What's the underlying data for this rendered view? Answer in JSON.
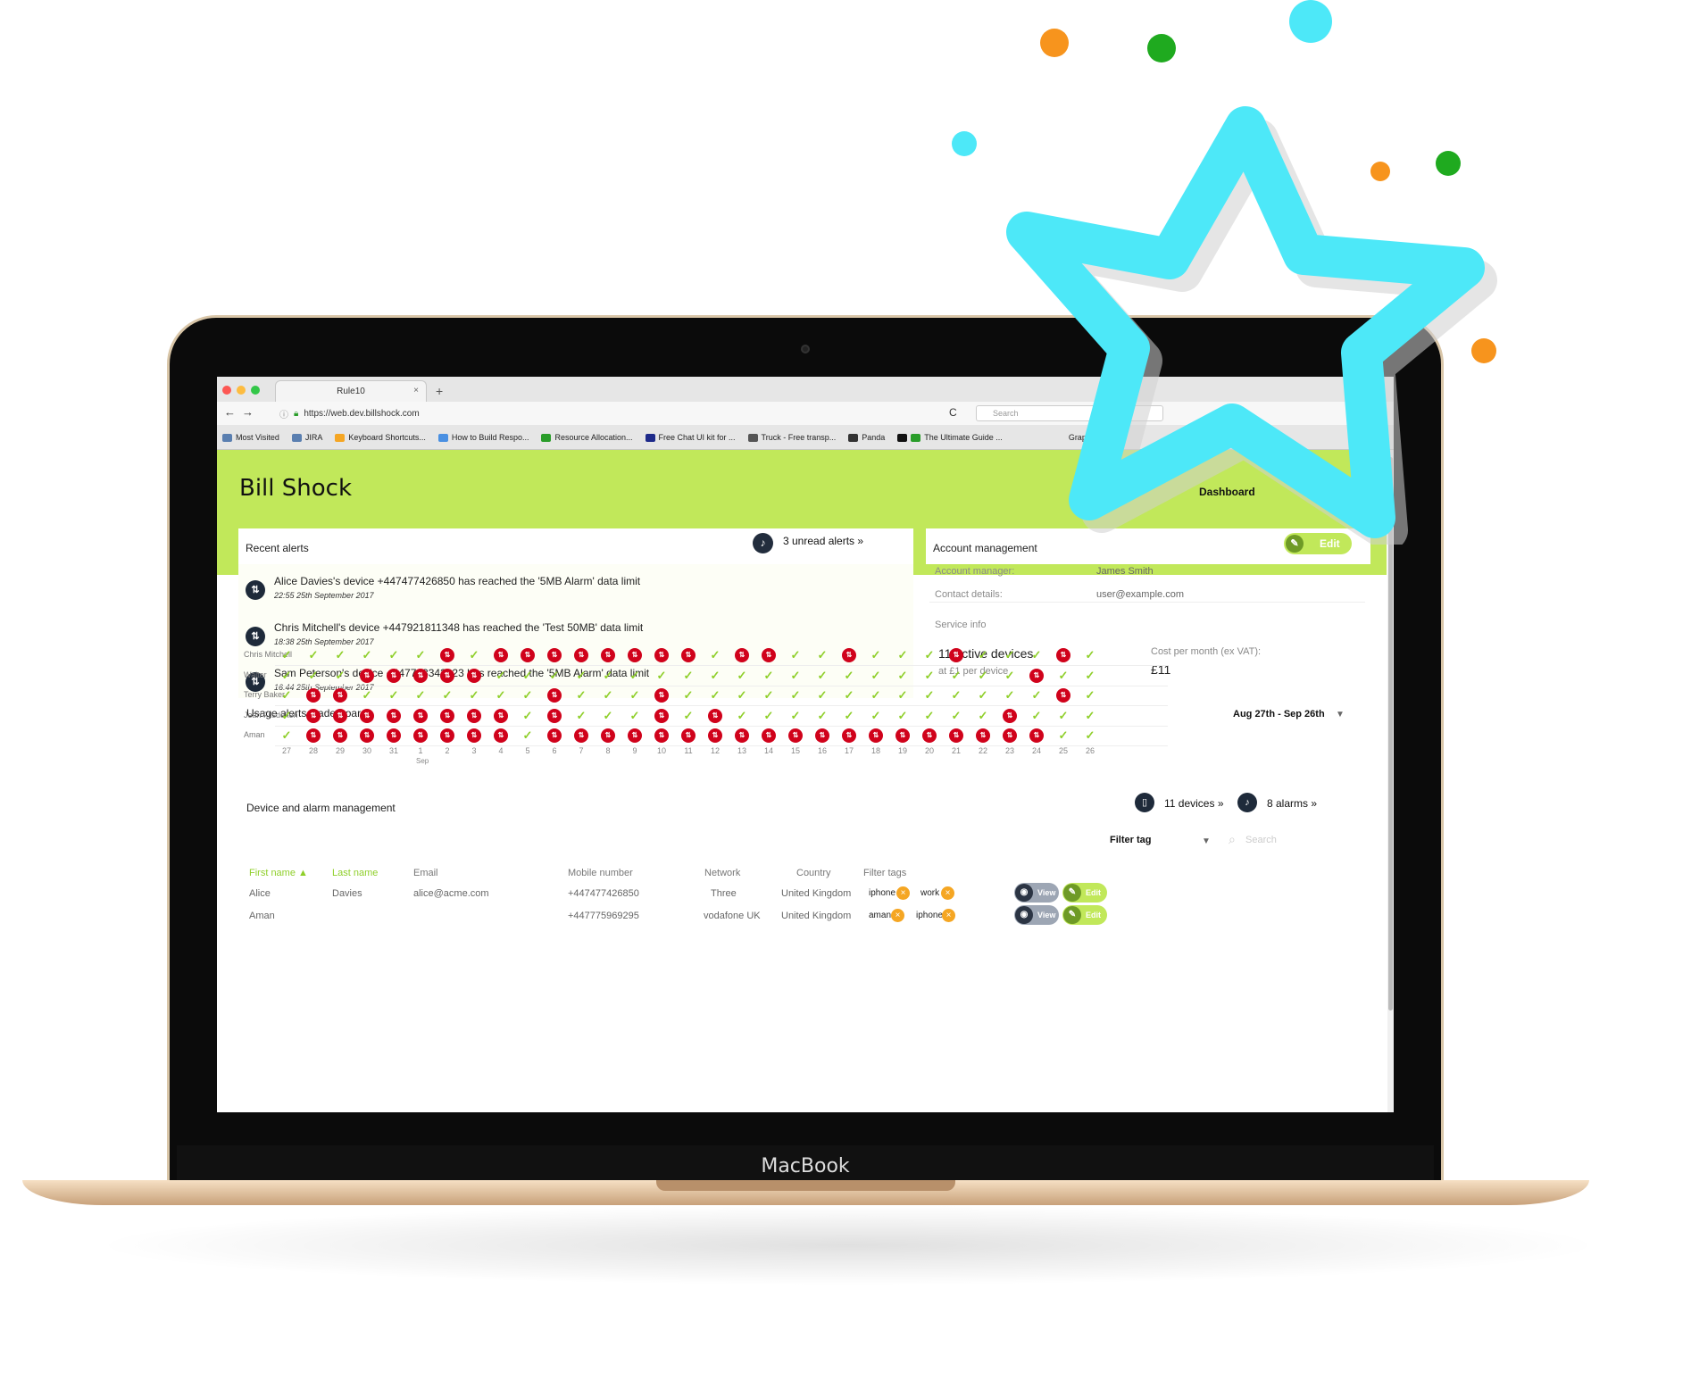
{
  "laptop": {
    "brand": "MacBook"
  },
  "browser": {
    "tab_title": "Rule10",
    "tab_close": "×",
    "new_tab": "+",
    "back": "←",
    "forward": "→",
    "url": "https://web.dev.billshock.com",
    "reload": "C",
    "search_placeholder": "Search",
    "bookmarks": [
      "Most Visited",
      "JIRA",
      "Keyboard Shortcuts...",
      "How to Build Respo...",
      "Resource Allocation...",
      "Free Chat UI kit for ...",
      "Truck - Free transp...",
      "Panda",
      "The Ultimate Guide ...",
      "GraphicBurger"
    ],
    "more": "»"
  },
  "app": {
    "title": "Bill Shock",
    "nav": {
      "dashboard": "Dashboard"
    }
  },
  "recent_alerts": {
    "title": "Recent alerts",
    "unread": "3 unread alerts »",
    "items": [
      {
        "text": "Alice Davies's device +447477426850 has reached the '5MB Alarm' data limit",
        "time": "22:55 25th September 2017"
      },
      {
        "text": "Chris Mitchell's device +447921811348 has reached the 'Test 50MB' data limit",
        "time": "18:38 25th September 2017"
      },
      {
        "text": "Sam Peterson's device +447763343023 has reached the '5MB Alarm' data limit",
        "time": "16:44 25th September 2017"
      }
    ]
  },
  "account": {
    "title": "Account management",
    "edit": "Edit",
    "manager_label": "Account manager:",
    "manager_value": "James Smith",
    "contact_label": "Contact details:",
    "contact_value": "user@example.com",
    "service_label": "Service info",
    "devices": "11 active devices",
    "per_device": "at £1 per device",
    "cost_label": "Cost per month (ex VAT):",
    "cost_value": "£11"
  },
  "leaderboard": {
    "title": "Usage alerts leaderboard",
    "range": "Aug 27th - Sep 26th",
    "days": [
      "27",
      "28",
      "29",
      "30",
      "31",
      "1",
      "2",
      "3",
      "4",
      "5",
      "6",
      "7",
      "8",
      "9",
      "10",
      "11",
      "12",
      "13",
      "14",
      "15",
      "16",
      "17",
      "18",
      "19",
      "20",
      "21",
      "22",
      "23",
      "24",
      "25",
      "26"
    ],
    "month_marker": "Sep",
    "rows": [
      {
        "name": "Chris Mitchell",
        "marks": "ooooooxoxxxxxxxxoxxooxoooxoooxo"
      },
      {
        "name": "Walter",
        "marks": "oooxxxxxooooooooooooooooooooxoo"
      },
      {
        "name": "Terry Baker",
        "marks": "oxxoooooooxoooxooooooooooooooxoo"
      },
      {
        "name": "Jean Filsdeken",
        "marks": "oxxxxxxxxoxoooxoxooooooooooxooo"
      },
      {
        "name": "Aman",
        "marks": "oxxxxxxxxoxxxxxxxxxxxxxxxxxxxoo"
      }
    ]
  },
  "devices": {
    "title": "Device and alarm management",
    "devices_link": "11 devices »",
    "alarms_link": "8 alarms »",
    "filter_label": "Filter tag",
    "search_placeholder": "Search",
    "headers": [
      "First name ▲",
      "Last name",
      "Email",
      "Mobile number",
      "Network",
      "Country",
      "Filter tags"
    ],
    "rows": [
      {
        "first": "Alice",
        "last": "Davies",
        "email": "alice@acme.com",
        "mobile": "+447477426850",
        "network": "Three",
        "country": "United Kingdom",
        "tags": [
          "iphone",
          "work"
        ]
      },
      {
        "first": "Aman",
        "last": "",
        "email": "",
        "mobile": "+447775969295",
        "network": "vodafone UK",
        "country": "United Kingdom",
        "tags": [
          "aman",
          "iphone"
        ]
      }
    ],
    "view": "View",
    "edit": "Edit"
  },
  "colors": {
    "accent": "#c1e85a",
    "dark": "#1e2a3a",
    "alert": "#d0021b",
    "ok": "#8fcf2a",
    "star": "#4de8f8"
  }
}
